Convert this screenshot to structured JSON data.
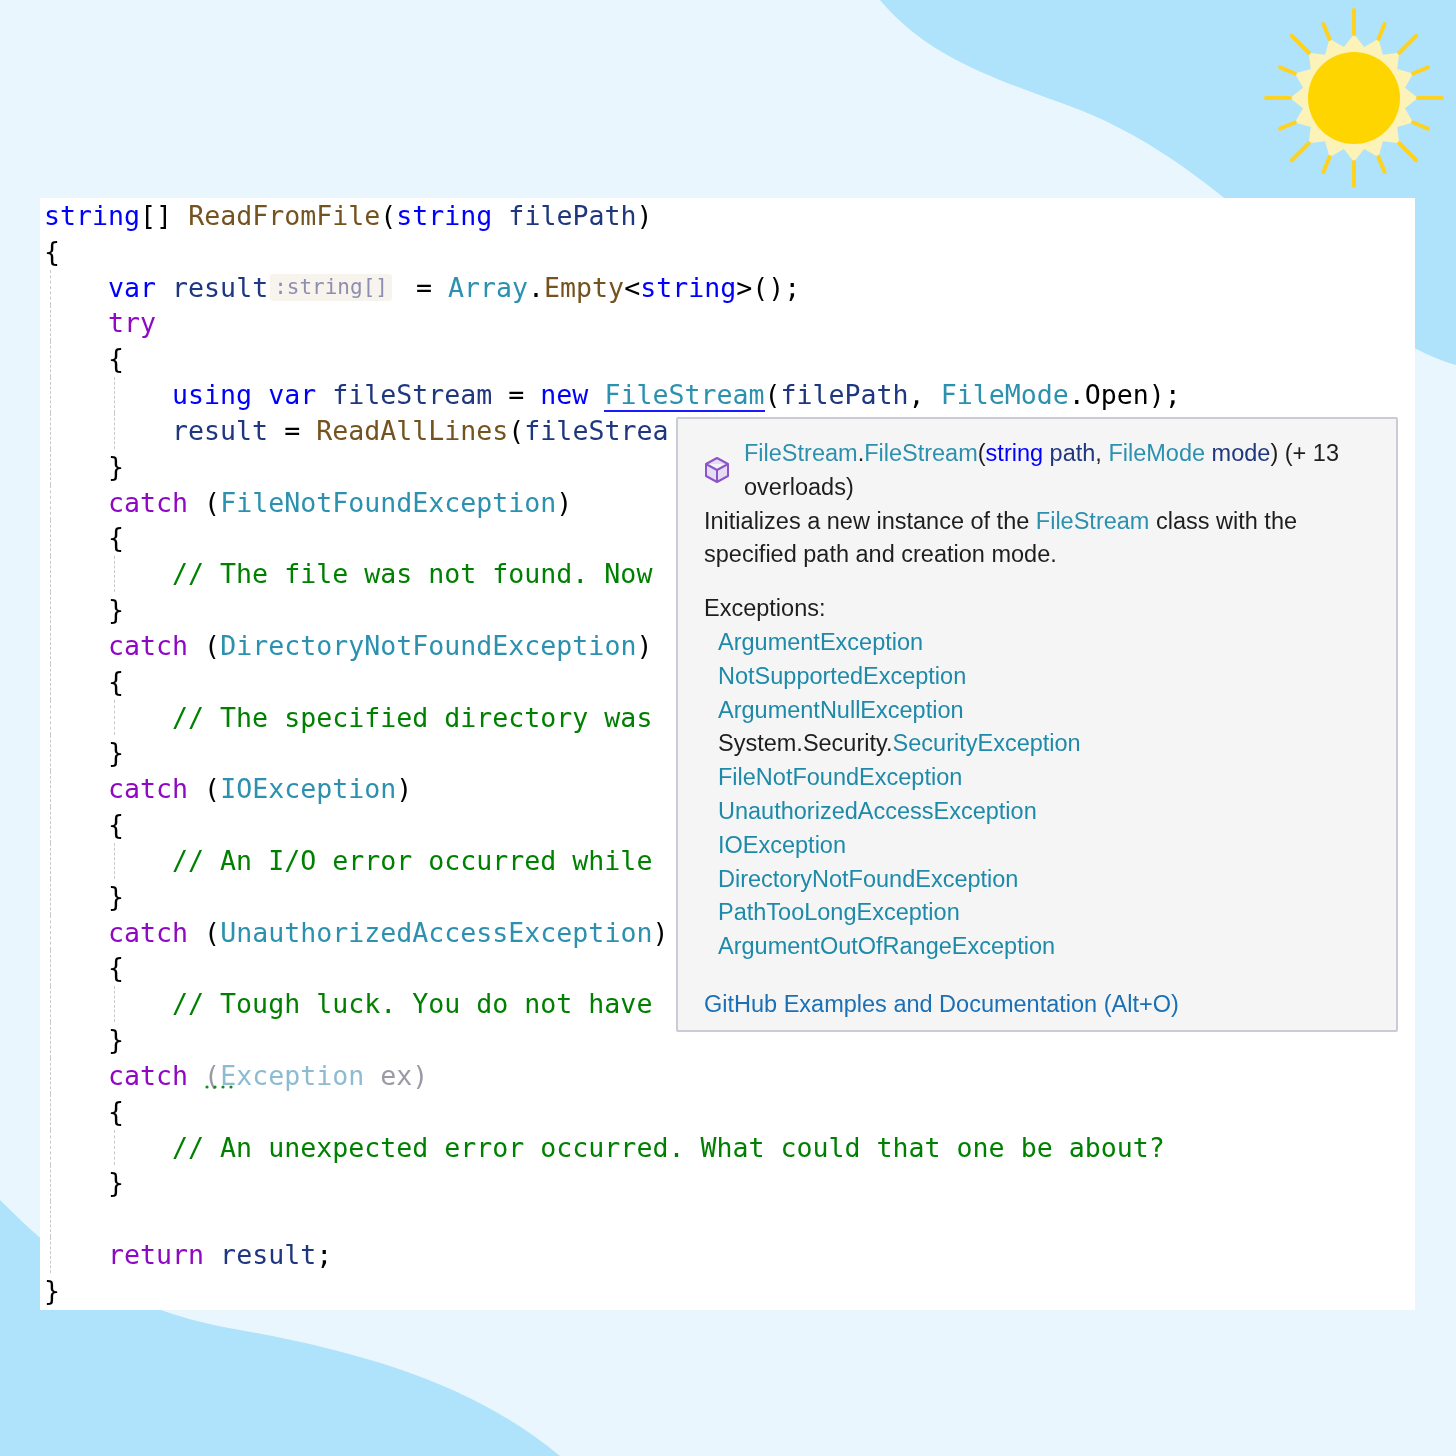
{
  "editor": {
    "lines": [
      {
        "tokens": [
          {
            "kind": "keyword",
            "text": "string"
          },
          {
            "kind": "punct",
            "text": "[] "
          },
          {
            "kind": "method",
            "text": "ReadFromFile"
          },
          {
            "kind": "punct",
            "text": "("
          },
          {
            "kind": "keyword",
            "text": "string"
          },
          {
            "kind": "ident",
            "text": " filePath"
          },
          {
            "kind": "punct",
            "text": ")"
          }
        ]
      },
      {
        "tokens": [
          {
            "kind": "punct",
            "text": "{"
          }
        ]
      },
      {
        "tokens": [
          {
            "kind": "keyword",
            "text": "    var"
          },
          {
            "kind": "ident",
            "text": " result"
          },
          {
            "kind": "hint",
            "text": ":string[]"
          },
          {
            "kind": "punct",
            "text": " = "
          },
          {
            "kind": "type",
            "text": "Array"
          },
          {
            "kind": "punct",
            "text": "."
          },
          {
            "kind": "method",
            "text": "Empty"
          },
          {
            "kind": "punct",
            "text": "<"
          },
          {
            "kind": "keyword",
            "text": "string"
          },
          {
            "kind": "punct",
            "text": ">();"
          }
        ]
      },
      {
        "tokens": [
          {
            "kind": "control",
            "text": "    try"
          }
        ]
      },
      {
        "tokens": [
          {
            "kind": "punct",
            "text": "    {"
          }
        ]
      },
      {
        "tokens": [
          {
            "kind": "keyword",
            "text": "        using"
          },
          {
            "kind": "keyword",
            "text": " var"
          },
          {
            "kind": "ident",
            "text": " fileStream"
          },
          {
            "kind": "punct",
            "text": " = "
          },
          {
            "kind": "keyword",
            "text": "new "
          },
          {
            "kind": "type",
            "text": "FileStream",
            "underline": true
          },
          {
            "kind": "punct",
            "text": "("
          },
          {
            "kind": "ident",
            "text": "filePath"
          },
          {
            "kind": "punct",
            "text": ", "
          },
          {
            "kind": "type",
            "text": "FileMode"
          },
          {
            "kind": "punct",
            "text": "."
          },
          {
            "kind": "punct",
            "text": "Open"
          },
          {
            "kind": "punct",
            "text": ");"
          }
        ]
      },
      {
        "tokens": [
          {
            "kind": "ident",
            "text": "        result"
          },
          {
            "kind": "punct",
            "text": " = "
          },
          {
            "kind": "method",
            "text": "ReadAllLines"
          },
          {
            "kind": "punct",
            "text": "("
          },
          {
            "kind": "ident",
            "text": "fileStrea"
          }
        ]
      },
      {
        "tokens": [
          {
            "kind": "punct",
            "text": "    }"
          }
        ]
      },
      {
        "tokens": [
          {
            "kind": "control",
            "text": "    catch"
          },
          {
            "kind": "punct",
            "text": " ("
          },
          {
            "kind": "type",
            "text": "FileNotFoundException"
          },
          {
            "kind": "punct",
            "text": ")"
          }
        ]
      },
      {
        "tokens": [
          {
            "kind": "punct",
            "text": "    {"
          }
        ]
      },
      {
        "tokens": [
          {
            "kind": "comment",
            "text": "        // The file was not found. Now"
          }
        ]
      },
      {
        "tokens": [
          {
            "kind": "punct",
            "text": "    }"
          }
        ]
      },
      {
        "tokens": [
          {
            "kind": "control",
            "text": "    catch"
          },
          {
            "kind": "punct",
            "text": " ("
          },
          {
            "kind": "type",
            "text": "DirectoryNotFoundException"
          },
          {
            "kind": "punct",
            "text": ")"
          }
        ]
      },
      {
        "tokens": [
          {
            "kind": "punct",
            "text": "    {"
          }
        ]
      },
      {
        "tokens": [
          {
            "kind": "comment",
            "text": "        // The specified directory was"
          }
        ]
      },
      {
        "tokens": [
          {
            "kind": "punct",
            "text": "    }"
          }
        ]
      },
      {
        "tokens": [
          {
            "kind": "control",
            "text": "    catch"
          },
          {
            "kind": "punct",
            "text": " ("
          },
          {
            "kind": "type",
            "text": "IOException"
          },
          {
            "kind": "punct",
            "text": ")"
          }
        ]
      },
      {
        "tokens": [
          {
            "kind": "punct",
            "text": "    {"
          }
        ]
      },
      {
        "tokens": [
          {
            "kind": "comment",
            "text": "        // An I/O error occurred while"
          }
        ]
      },
      {
        "tokens": [
          {
            "kind": "punct",
            "text": "    }"
          }
        ]
      },
      {
        "tokens": [
          {
            "kind": "control",
            "text": "    catch"
          },
          {
            "kind": "punct",
            "text": " ("
          },
          {
            "kind": "type",
            "text": "UnauthorizedAccessException"
          },
          {
            "kind": "punct",
            "text": ")"
          }
        ]
      },
      {
        "tokens": [
          {
            "kind": "punct",
            "text": "    {"
          }
        ]
      },
      {
        "tokens": [
          {
            "kind": "comment",
            "text": "        // Tough luck. You do not have"
          }
        ]
      },
      {
        "tokens": [
          {
            "kind": "punct",
            "text": "    }"
          }
        ]
      },
      {
        "tokens": [
          {
            "kind": "control",
            "text": "    catch "
          },
          {
            "kind": "faded",
            "text": "(",
            "suggestion": true
          },
          {
            "kind": "faded-type",
            "text": "Exception"
          },
          {
            "kind": "faded",
            "text": " ex)"
          }
        ]
      },
      {
        "tokens": [
          {
            "kind": "punct",
            "text": "    {"
          }
        ]
      },
      {
        "tokens": [
          {
            "kind": "comment",
            "text": "        // An unexpected error occurred. What could that one be about?"
          }
        ]
      },
      {
        "tokens": [
          {
            "kind": "punct",
            "text": "    }"
          }
        ]
      },
      {
        "kind": "blank"
      },
      {
        "tokens": [
          {
            "kind": "control",
            "text": "    return"
          },
          {
            "kind": "ident",
            "text": " result"
          },
          {
            "kind": "punct",
            "text": ";"
          }
        ]
      },
      {
        "tokens": [
          {
            "kind": "punct",
            "text": "}"
          }
        ]
      }
    ]
  },
  "tooltip": {
    "signature": [
      {
        "kind": "type",
        "text": "FileStream"
      },
      {
        "kind": "plain",
        "text": "."
      },
      {
        "kind": "type",
        "text": "FileStream"
      },
      {
        "kind": "plain",
        "text": "("
      },
      {
        "kind": "keyword",
        "text": "string"
      },
      {
        "kind": "param",
        "text": " path"
      },
      {
        "kind": "plain",
        "text": ", "
      },
      {
        "kind": "type",
        "text": "FileMode"
      },
      {
        "kind": "param",
        "text": " mode"
      },
      {
        "kind": "plain",
        "text": ") (+ 13 overloads)"
      }
    ],
    "description": [
      {
        "kind": "plain",
        "text": "Initializes a new instance of the "
      },
      {
        "kind": "type",
        "text": "FileStream"
      },
      {
        "kind": "plain",
        "text": " class with the specified path and creation mode."
      }
    ],
    "exceptions_label": "Exceptions:",
    "exceptions": [
      {
        "name": "ArgumentException"
      },
      {
        "name": "NotSupportedException"
      },
      {
        "name": "ArgumentNullException"
      },
      {
        "namespace": "System.Security.",
        "name": "SecurityException"
      },
      {
        "name": "FileNotFoundException"
      },
      {
        "name": "UnauthorizedAccessException"
      },
      {
        "name": "IOException"
      },
      {
        "name": "DirectoryNotFoundException"
      },
      {
        "name": "PathTooLongException"
      },
      {
        "name": "ArgumentOutOfRangeException"
      }
    ],
    "footer_link": "GitHub Examples and Documentation (Alt+O)"
  }
}
